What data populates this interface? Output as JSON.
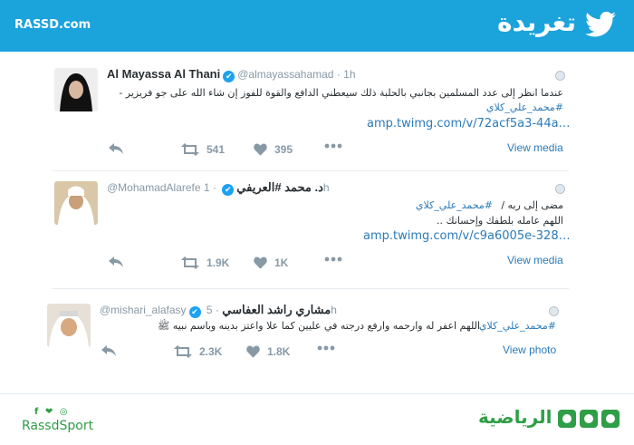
{
  "header": {
    "site": "RASSD.com",
    "title": "تغريدة"
  },
  "tweets": [
    {
      "name": "Al Mayassa Al Thani",
      "handle": "@almayassahamad",
      "time": "· 1h",
      "line1": "عندما انظر إلى عدد المسلمين بجانبي بالحلبة ذلك سيعطني الدافع والقوة للفوز إن شاء الله على جو فريزير -",
      "hashtag": "#محمد_علي_كلاي",
      "link": "amp.twimg.com/v/72acf5a3-44a…",
      "retweets": "541",
      "likes": "395",
      "media_label": "View media"
    },
    {
      "name": "د. محمد #العريفي",
      "handle": "@MohamadAlarefe",
      "time": "· 1h",
      "line_pre": "مضى إلى ربه /",
      "hashtag": "#محمد_علي_كلاي",
      "line2": "اللهم عامله بلطفك وإحسانك ..",
      "link": "amp.twimg.com/v/c9a6005e-328…",
      "retweets": "1.9K",
      "likes": "1K",
      "media_label": "View media"
    },
    {
      "name": "مشاري راشد العفاسي",
      "handle": "@mishari_alafasy",
      "time": "· 5h",
      "hashtag": "#محمد_علي_كلاي",
      "line1": "اللهم اعفر له وارحمه وارفع درجته في عليين كما علا واعتز بدينه وباسم نبيه ﷺ",
      "retweets": "2.3K",
      "likes": "1.8K",
      "media_label": "View photo"
    }
  ],
  "footer": {
    "social_icons": "f ❤ ◎",
    "brand_en": "RassdSport",
    "brand_ar": "الرياضية"
  },
  "colors": {
    "header_bg": "#1ba3dc",
    "link": "#2b7bb9",
    "brand_green": "#2e9e47"
  }
}
